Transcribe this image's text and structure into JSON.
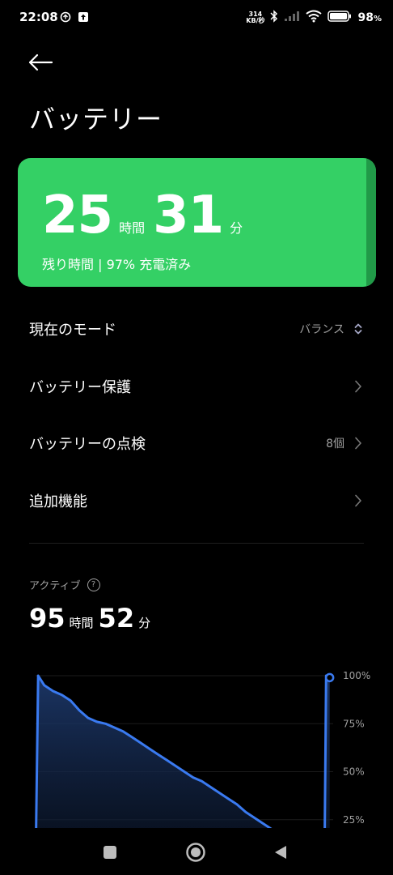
{
  "status_bar": {
    "time": "22:08",
    "speed_value": "314",
    "speed_unit": "KB/秒",
    "battery_percent": "98",
    "battery_percent_sign": "%"
  },
  "header": {
    "title": "バッテリー"
  },
  "battery_card": {
    "hours": "25",
    "hours_unit": "時間",
    "minutes": "31",
    "minutes_unit": "分",
    "subtitle": "残り時間 | 97% 充電済み",
    "color": "#34d065"
  },
  "menu": {
    "current_mode": {
      "label": "現在のモード",
      "value": "バランス"
    },
    "battery_protection": {
      "label": "バッテリー保護"
    },
    "battery_check": {
      "label": "バッテリーの点検",
      "value": "8個"
    },
    "extra_features": {
      "label": "追加機能"
    }
  },
  "active": {
    "label": "アクティブ",
    "hours": "95",
    "hours_unit": "時間",
    "minutes": "52",
    "minutes_unit": "分"
  },
  "chart_data": {
    "type": "area",
    "y_ticks": [
      "100%",
      "75%",
      "50%",
      "25%"
    ],
    "ylim": [
      0,
      100
    ],
    "series": [
      {
        "values": [
          [
            0,
            0
          ],
          [
            0.3,
            100
          ],
          [
            1,
            95
          ],
          [
            2,
            92
          ],
          [
            3,
            90
          ],
          [
            4,
            87
          ],
          [
            5,
            82
          ],
          [
            6,
            78
          ],
          [
            7,
            76
          ],
          [
            8,
            75
          ],
          [
            9,
            73
          ],
          [
            10,
            71
          ],
          [
            11,
            68
          ],
          [
            12,
            65
          ],
          [
            13,
            62
          ],
          [
            14,
            59
          ],
          [
            15,
            56
          ],
          [
            16,
            53
          ],
          [
            17,
            50
          ],
          [
            18,
            47
          ],
          [
            19,
            45
          ],
          [
            20,
            42
          ],
          [
            21,
            39
          ],
          [
            22,
            36
          ],
          [
            23,
            33
          ],
          [
            24,
            29
          ],
          [
            25,
            26
          ],
          [
            26,
            23
          ],
          [
            27,
            20
          ]
        ]
      },
      {
        "values": [
          [
            33,
            0
          ],
          [
            33.2,
            100
          ],
          [
            33.6,
            99
          ]
        ]
      }
    ],
    "accent_color": "#3a7af0",
    "grid": true
  },
  "nav": {
    "recents_icon": "square-icon",
    "home_icon": "circle-icon",
    "back_icon": "triangle-back-icon"
  }
}
